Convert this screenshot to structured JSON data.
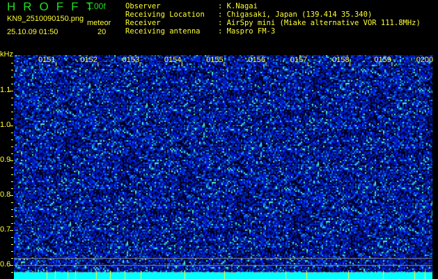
{
  "header": {
    "app_title": "HROFFT",
    "version": "1.00f",
    "filename": "KN9_2510090150.png",
    "datetime": "25.10.09 01:50",
    "meteor_label": "meteor",
    "meteor_count": "20"
  },
  "info": [
    {
      "label": "Observer",
      "value": "K.Nagai"
    },
    {
      "label": "Receiving Location",
      "value": "Chigasaki, Japan (139.414 35.340)"
    },
    {
      "label": "Receiver",
      "value": "AirSpy mini (Miake alternative VOR 111.8MHz)"
    },
    {
      "label": "Receiving antenna",
      "value": "Maspro FM-3"
    }
  ],
  "axis": {
    "unit": "kHz",
    "y_ticks": [
      "1.1",
      "1.0",
      "0.9",
      "0.8",
      "0.7",
      "0.6"
    ],
    "time_ticks": [
      "0151",
      "0152",
      "0153",
      "0154",
      "0155",
      "0156",
      "0157",
      "0158",
      "0159",
      "0200"
    ]
  },
  "colors": {
    "text": "#ffff33",
    "title": "#22dd22",
    "noise_band": "#00ffff"
  }
}
